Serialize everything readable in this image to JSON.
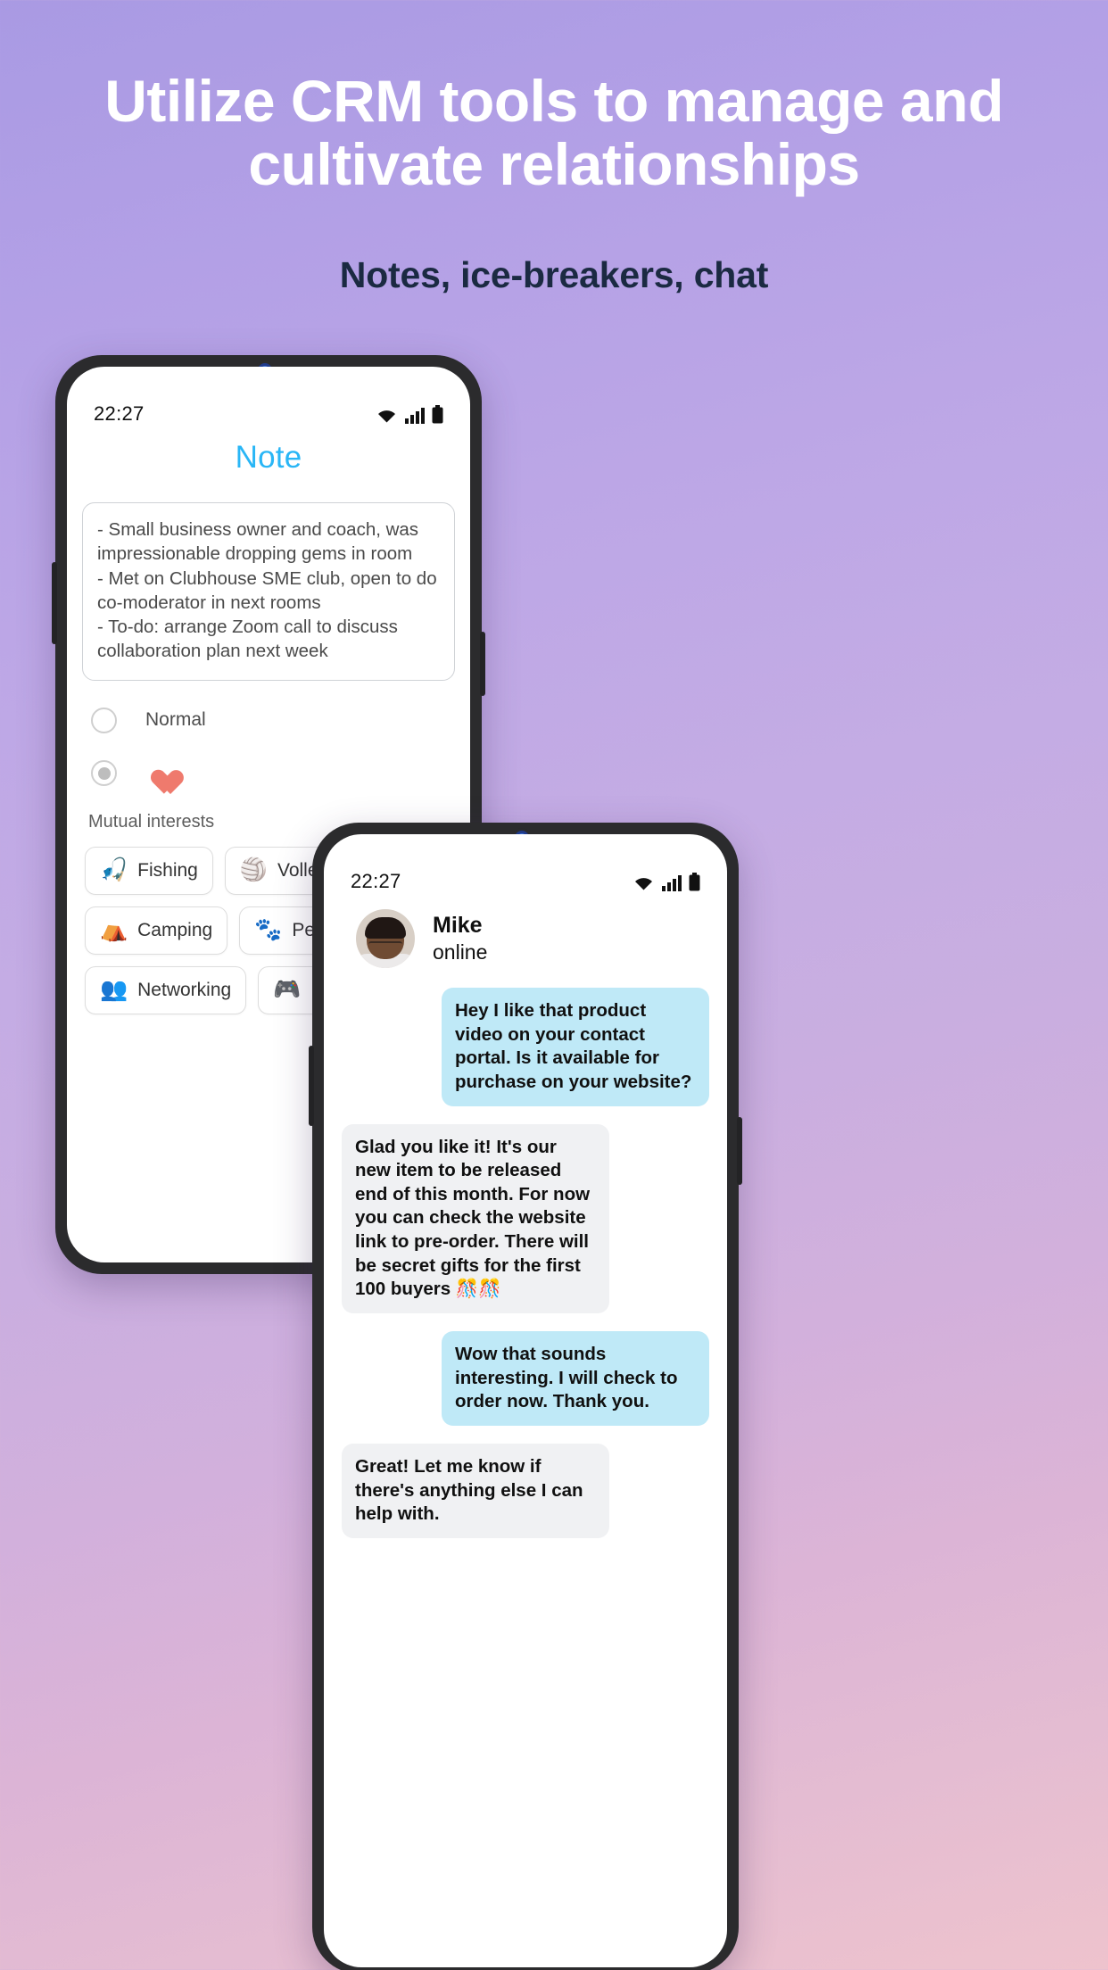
{
  "header": {
    "headline_accent": "Utilize",
    "headline_rest": " CRM tools to manage and cultivate relationships",
    "subhead": "Notes, ice-breakers, chat",
    "accent_color": "#1b2a42",
    "headline_color": "#ffffff"
  },
  "note_phone": {
    "status": {
      "time": "22:27",
      "icons": [
        "wifi-icon",
        "signal-icon",
        "battery-icon"
      ]
    },
    "title": "Note",
    "note_lines": [
      "- Small business owner and coach, was impressionable dropping gems in room",
      "- Met on Clubhouse SME club, open to do co-moderator in next rooms",
      "- To-do: arrange Zoom call to discuss collaboration plan next week"
    ],
    "options": [
      {
        "label": "Normal",
        "selected": false,
        "type": "text"
      },
      {
        "label": "",
        "selected": true,
        "type": "heart",
        "color": "#ef7a6d"
      }
    ],
    "interests_label": "Mutual interests",
    "interests": [
      {
        "emoji": "🎣",
        "icon": "fishing-icon",
        "label": "Fishing"
      },
      {
        "emoji": "🏐",
        "icon": "volleyball-icon",
        "label": "Volleyball"
      },
      {
        "emoji": "⛺",
        "icon": "camping-icon",
        "label": "Camping"
      },
      {
        "emoji": "🐾",
        "icon": "pets-icon",
        "label": "Pets"
      },
      {
        "emoji": "👥",
        "icon": "networking-icon",
        "label": "Networking"
      },
      {
        "emoji": "🎮",
        "icon": "gaming-icon",
        "label": ""
      }
    ]
  },
  "chat_phone": {
    "status": {
      "time": "22:27",
      "icons": [
        "wifi-icon",
        "signal-icon",
        "battery-icon"
      ]
    },
    "contact_name": "Mike",
    "contact_status": "online",
    "messages": [
      {
        "direction": "out",
        "text": "Hey I like that product video on your contact portal. Is it available for purchase on your website?"
      },
      {
        "direction": "in",
        "text": "Glad you like it! It's our new item to be released end of this month. For now you can check the website link to pre-order. There will be secret gifts for the first 100 buyers 🎊🎊"
      },
      {
        "direction": "out",
        "text": "Wow that sounds interesting. I will check to order now. Thank you."
      },
      {
        "direction": "in",
        "text": "Great! Let me know if there's anything else I can help with."
      }
    ],
    "bubble_out_color": "#bfe9f7",
    "bubble_in_color": "#f0f1f3"
  }
}
